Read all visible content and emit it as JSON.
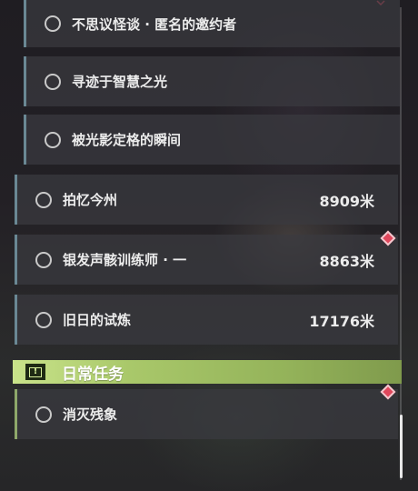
{
  "quests": [
    {
      "title": "不思议怪谈 · 匿名的邀约者",
      "distance": ""
    },
    {
      "title": "寻迹于智慧之光",
      "distance": ""
    },
    {
      "title": "被光影定格的瞬间",
      "distance": ""
    },
    {
      "title": "拍忆今州",
      "distance": "8909米"
    },
    {
      "title": "银发声骸训练师 · 一",
      "distance": "8863米"
    },
    {
      "title": "旧日的试炼",
      "distance": "17176米"
    }
  ],
  "daily": {
    "header": "日常任务",
    "items": [
      {
        "title": "消灭残象",
        "distance": ""
      }
    ]
  },
  "colors": {
    "accent_blue": "#6a8894",
    "accent_green": "#a9c86a",
    "tracker_marker": "#e0475c"
  },
  "icons": {
    "quest_status": "circle-outline-icon",
    "daily_header": "exclamation-box-icon",
    "tracker": "diamond-marker-icon"
  }
}
